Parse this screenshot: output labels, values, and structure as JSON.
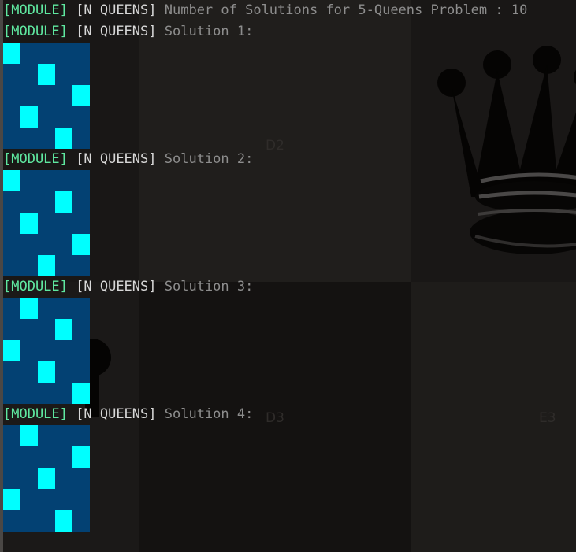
{
  "background": {
    "coords": [
      "D2",
      "D3",
      "E3"
    ]
  },
  "log": {
    "module_tag": "[MODULE]",
    "category_tag": "[N QUEENS]",
    "summary": "Number of Solutions for 5-Queens Problem : 10",
    "solutions": [
      {
        "label": "Solution 1:",
        "queens": [
          0,
          2,
          4,
          1,
          3
        ]
      },
      {
        "label": "Solution 2:",
        "queens": [
          0,
          3,
          1,
          4,
          2
        ]
      },
      {
        "label": "Solution 3:",
        "queens": [
          1,
          3,
          0,
          2,
          4
        ]
      },
      {
        "label": "Solution 4:",
        "queens": [
          1,
          4,
          2,
          0,
          3
        ]
      }
    ]
  },
  "colors": {
    "module_tag": "#5fe8a0",
    "message": "#8d8d8d",
    "board_background": "#034173",
    "queen": "#00ffff"
  }
}
